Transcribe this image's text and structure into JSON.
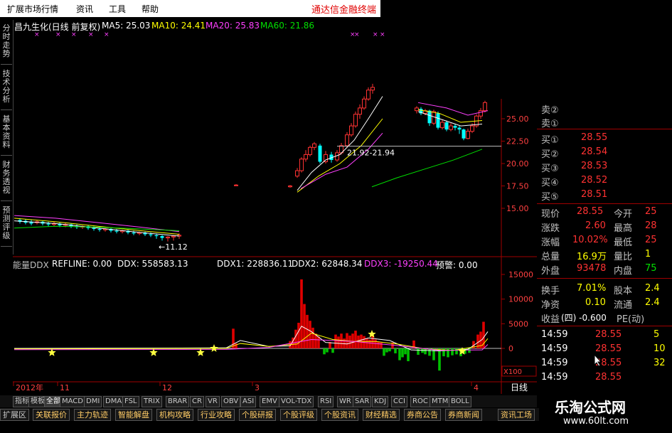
{
  "menu": {
    "items": [
      "扩展市场行情",
      "资讯",
      "工具",
      "帮助"
    ],
    "brand": "通达信金融终端"
  },
  "left_tabs": [
    "分时走势",
    "技术分析",
    "基本资料",
    "财务透视",
    "预测评级"
  ],
  "price_panel": {
    "title": "昌九生化(日线 前复权)",
    "ma": [
      {
        "label": "MA5: 25.03",
        "color": "#ffffff"
      },
      {
        "label": "MA10: 24.41",
        "color": "#ffff00"
      },
      {
        "label": "MA20: 25.83",
        "color": "#ff40ff"
      },
      {
        "label": "MA60: 21.86",
        "color": "#00e000"
      }
    ],
    "y_ticks": [
      "25.00",
      "22.50",
      "20.00",
      "17.50",
      "15.00"
    ],
    "annotation_range": "21.92-21.94",
    "annotation_low": "←11.12"
  },
  "ddx_panel": {
    "header": [
      {
        "label": "能量DDX",
        "color": "#c0c0c0"
      },
      {
        "label": "REFLINE: 0.00",
        "color": "#ffffff"
      },
      {
        "label": "DDX: 558583.13",
        "color": "#ffffff"
      },
      {
        "label": "DDX1: 228836.11",
        "color": "#ffffff"
      },
      {
        "label": "DDX2: 62848.34",
        "color": "#ffffff"
      },
      {
        "label": "DDX3: -19250.44",
        "color": "#ff40ff"
      },
      {
        "label": "预警: 0.00",
        "color": "#ffffff"
      }
    ],
    "y_ticks": [
      "15000",
      "10000",
      "5000",
      "0"
    ],
    "unit": "X100"
  },
  "date_axis": {
    "labels": [
      "2012年",
      "11",
      "12",
      "3",
      "4"
    ],
    "period": "日线"
  },
  "quote": {
    "asks": [
      {
        "label": "卖②",
        "price": "",
        "vol": ""
      },
      {
        "label": "卖①",
        "price": "",
        "vol": ""
      }
    ],
    "bids": [
      {
        "label": "买①",
        "price": "28.55"
      },
      {
        "label": "买②",
        "price": "28.54"
      },
      {
        "label": "买③",
        "price": "28.53"
      },
      {
        "label": "买④",
        "price": "28.52"
      },
      {
        "label": "买⑤",
        "price": "28.51"
      }
    ],
    "stats": [
      {
        "l1": "现价",
        "v1": "28.55",
        "l2": "今开",
        "v2": "25"
      },
      {
        "l1": "涨跌",
        "v1": "2.60",
        "l2": "最高",
        "v2": "28"
      },
      {
        "l1": "涨幅",
        "v1": "10.02%",
        "l2": "最低",
        "v2": "25"
      },
      {
        "l1": "总量",
        "v1": "16.9万",
        "l2": "量比",
        "v2": "1"
      },
      {
        "l1": "外盘",
        "v1": "93478",
        "l2": "内盘",
        "v2": "75"
      }
    ],
    "extra": [
      {
        "l1": "换手",
        "v1": "7.01%",
        "l2": "股本",
        "v2": "2.4"
      },
      {
        "l1": "净资",
        "v1": "0.10",
        "l2": "流通",
        "v2": "2.4"
      },
      {
        "l1": "收益",
        "v1": "(四) -0.600",
        "l2": "PE(动)",
        "v2": ""
      }
    ],
    "ticks": [
      {
        "time": "14:59",
        "price": "28.55",
        "vol": "5"
      },
      {
        "time": "14:59",
        "price": "28.55",
        "vol": "10"
      },
      {
        "time": "14:59",
        "price": "28.55",
        "vol": "32"
      },
      {
        "time": "14:59",
        "price": "28.55",
        "vol": ""
      }
    ]
  },
  "indicator_tabs": [
    "指标",
    "模板",
    "全部",
    "MACD",
    "DMI",
    "DMA",
    "FSL",
    "TRIX",
    "BRAR",
    "CR",
    "VR",
    "OBV",
    "ASI",
    "EMV",
    "VOL-TDX",
    "RSI",
    "WR",
    "SAR",
    "KDJ",
    "CCI",
    "ROC",
    "MTM",
    "BOLL"
  ],
  "bottom_tabs": [
    "扩展区",
    "关联报价",
    "主力轨迹",
    "智能解盘",
    "机构攻略",
    "行业攻略",
    "个股研报",
    "个股评级",
    "个股资讯",
    "财经精选",
    "券商公告",
    "券商新闻",
    "资讯工场"
  ],
  "watermark": {
    "title": "乐淘公式网",
    "url": "www.60lt.com"
  },
  "colors": {
    "up": "#ff3232",
    "down": "#00ffff",
    "ddx_up": "#e00000",
    "ddx_down": "#00c000",
    "frame": "#a00000",
    "star": "#ffff40"
  }
}
